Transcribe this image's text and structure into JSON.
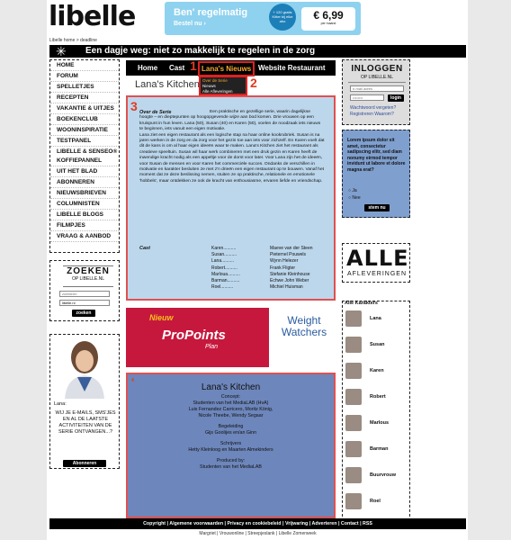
{
  "logo": "libelle",
  "breadcrumb": "Libelle home > deadline",
  "banner": {
    "line1": "Ben' regelmatig",
    "line2": "Bestel nu ›",
    "badge": "+ 120 gratis Kitter bij elke abo",
    "price": "€ 6,99",
    "price_sub": "per maand"
  },
  "headline": "Een dagje weg: niet zo makkelijk te regelen in de zorg",
  "leftnav": [
    "HOME",
    "FORUM",
    "SPELLETJES",
    "RECEPTEN",
    "VAKANTIE & UITJES",
    "BOEKENCLUB",
    "WOONINSPIRATIE",
    "TESTPANEL",
    "LIBELLE & SENSEO® KOFFIEPANNEL",
    "UIT HET BLAD",
    "ABONNEREN",
    "NIEUWSBRIEVEN",
    "COLUMNISTEN",
    "LIBELLE BLOGS",
    "FILMPJES",
    "VRAAG & AANBOD"
  ],
  "zoeken": {
    "title": "ZOEKEN",
    "sub": "OP LIBELLE.NL",
    "input1": "zoekterm",
    "select": "libelle.nl",
    "button": "zoeken"
  },
  "lana_box": {
    "name": "Lana:",
    "text": "WIJ JE E-MAILS, SMS'JES EN AL DE LAATSTE ACTIVITEITEN VAN DE SERIE ONTVANGEN...?",
    "button": "Abonneren"
  },
  "nav": {
    "home": "Home",
    "cast": "Cast",
    "lana": "Lana's Nieuws",
    "website": "Website Restaurant"
  },
  "dropdown": [
    "Over de Serie",
    "Nieuws",
    "Alle Afleveringen"
  ],
  "page_title": "Lana's Kitchen",
  "markers": {
    "m1": "1",
    "m2": "2",
    "m3": "3",
    "m4": "4"
  },
  "serie": {
    "heading": "Over de Serie",
    "text": "Een praktische en gezellige serie, waarin dagelijkse hoogte – en dieptepunten op hoogopgevende wijze aan bod komen. Drie vrouwen op een kruispunt in hun leven. Lana (50), Susan (40) en Karen (50), voelen de noodzaak iets nieuws te beginnen, iets vanuit een eigen motivatie.\nLana ziet een eigen restaurant als een logische stap na haar online kookrubriek. Susan is na jaren werken in de zorg en da zorg voor het gezin toe aan iets voor zichzelf. En Karen voelt dat dit de kans is om al haar eigen ideeën waar te maken. Lana's Kitchen ziet het restaurant als creatieve speeltuin. Susan wil haar werk combineren met een druk gezin en Karen heeft de inwendige kracht nodig als een appeltje voor de dorst voor later. Voor Lana zijn het de ideeën, voor Susan de mensen en voor Karen het commerciële succes. Ondanks de verschillen in motivatie en karakter besluiten ze met z'n drieën een eigen restaurant op te bouwen. Vanaf het moment dat ze deze beslissing nemen, stuiten ze op praktische, relationele en emotionele 'hobbels', maar ontdekken ze ook de kracht van enthousiasme, ervaren liefde en vriendschap."
  },
  "cast": {
    "label": "Cast",
    "roles": [
      "Karen..........",
      "Susan..........",
      "Lana..........",
      "Robert..........",
      "Marloua..........",
      "Barman..........",
      "Roel.........."
    ],
    "actors": [
      "Maeve van der Steen",
      "Pieternel Pouwels",
      "Wynn Helezer",
      "Frank Fligter",
      "Stefanie Kleinhouse",
      "Echwe John Weber",
      "Michiel Huisman"
    ]
  },
  "ad": {
    "nieuw": "Nieuw",
    "propoints": "ProPoints",
    "plan": "Plan",
    "ww": "Weight Watchers"
  },
  "credits": {
    "title": "Lana's Kitchen",
    "lines": [
      "Concept:",
      "Studenten van het MediaLAB (HvA)",
      "Luis Fernandez Carricero, Moritz König,",
      "Nicole Theebe, Wendy Segaar",
      "",
      "Begeleiding",
      "Gijs Goolijes en/an Ginn",
      "",
      "Schrijvers",
      "Hetty Kleinloog en Maarten Almekinders",
      "",
      "Produced by:",
      "Studenten van het MediaLAB"
    ]
  },
  "inloggen": {
    "title": "INLOGGEN",
    "sub": "OP LIBELLE.NL",
    "email": "e-mail adres",
    "pass": "••••••••",
    "button": "login",
    "forgot": "Wachtwoord vergeten?",
    "register": "Registreren  Waarom?"
  },
  "lorem": {
    "text": "Lorem ipsum dolor sit amet, consectetur sadipscing elitr, sed diam nonumy eirmod tempor invidunt ut labore et dolore magna erat?",
    "opt1": "Ja",
    "opt2": "Nee",
    "button": "stem nu"
  },
  "alle": {
    "title": "ALLE",
    "sub": "AFLEVERINGEN"
  },
  "karakters": {
    "title": "Alle Karakters",
    "names": [
      "Lana",
      "Susan",
      "Karen",
      "Robert",
      "Marlous",
      "Barman",
      "Buurvrouw",
      "Roel"
    ]
  },
  "footer": "Copyright | Algemene voorwaarden | Privacy en cookiebeleid | Vrijwaring | Adverteren | Contact | RSS",
  "sublinks": "Margriet | Vrouwonline | Streepjeslank | Libelle Zomerweek"
}
